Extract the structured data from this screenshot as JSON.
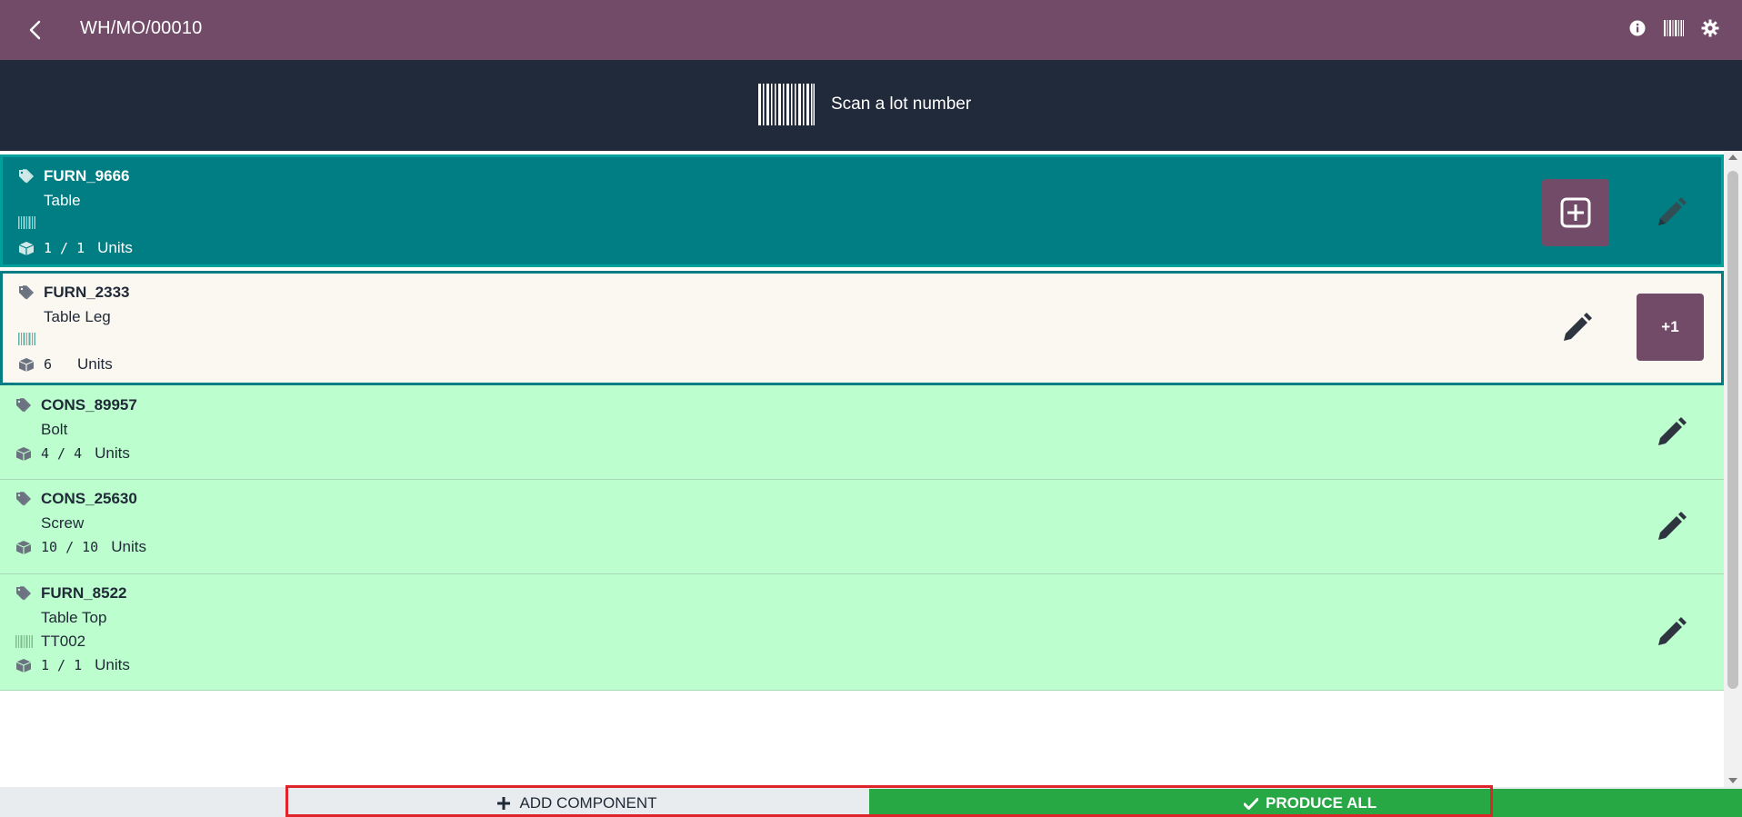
{
  "header": {
    "title": "WH/MO/00010",
    "icons": [
      "chevron-left-icon",
      "info-icon",
      "barcode-icon",
      "gear-icon"
    ]
  },
  "scan": {
    "text": "Scan a lot number",
    "icon": "barcode-icon"
  },
  "lines": [
    {
      "code": "FURN_9666",
      "product": "Table",
      "lot": "",
      "qty": "1 / 1",
      "unit": "Units",
      "state": "selected"
    },
    {
      "code": "FURN_2333",
      "product": "Table Leg",
      "lot": "",
      "qty": "6",
      "unit": "Units",
      "state": "active",
      "increment_label": "+1"
    },
    {
      "code": "CONS_89957",
      "product": "Bolt",
      "qty": "4 / 4",
      "unit": "Units",
      "state": "done"
    },
    {
      "code": "CONS_25630",
      "product": "Screw",
      "qty": "10 / 10",
      "unit": "Units",
      "state": "done"
    },
    {
      "code": "FURN_8522",
      "product": "Table Top",
      "lot": "TT002",
      "qty": "1 / 1",
      "unit": "Units",
      "state": "done"
    }
  ],
  "footer": {
    "add_component": "ADD COMPONENT",
    "produce_all": "PRODUCE ALL"
  },
  "colors": {
    "brand": "#714B67",
    "banner": "#212a3a",
    "selected": "#017e84",
    "done": "#bcfecd",
    "produce": "#28a745",
    "highlight": "#e0242b"
  }
}
